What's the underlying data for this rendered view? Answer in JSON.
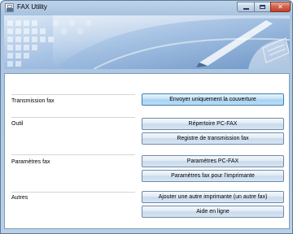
{
  "window": {
    "title": "FAX Utility"
  },
  "icons": {
    "app": "fax-icon",
    "minimize": "minimize-icon",
    "maximize": "maximize-icon",
    "close": "close-icon"
  },
  "colors": {
    "close_button": "#c94a34",
    "title_bar": "#b9d0e8",
    "button_border": "#6e8aa6"
  },
  "groups": {
    "transmission": {
      "label": "Transmission fax",
      "buttons": [
        "Envoyer uniquement la couverture"
      ]
    },
    "outil": {
      "label": "Outil",
      "buttons": [
        "Répertoire PC-FAX",
        "Registre de transmission fax"
      ]
    },
    "parametres": {
      "label": "Paramètres fax",
      "buttons": [
        "Paramètres PC-FAX",
        "Paramètres fax pour l'imprimante"
      ]
    },
    "autres": {
      "label": "Autres",
      "buttons": [
        "Ajouter une autre imprimante (un autre fax)",
        "Aide en ligne"
      ]
    }
  }
}
